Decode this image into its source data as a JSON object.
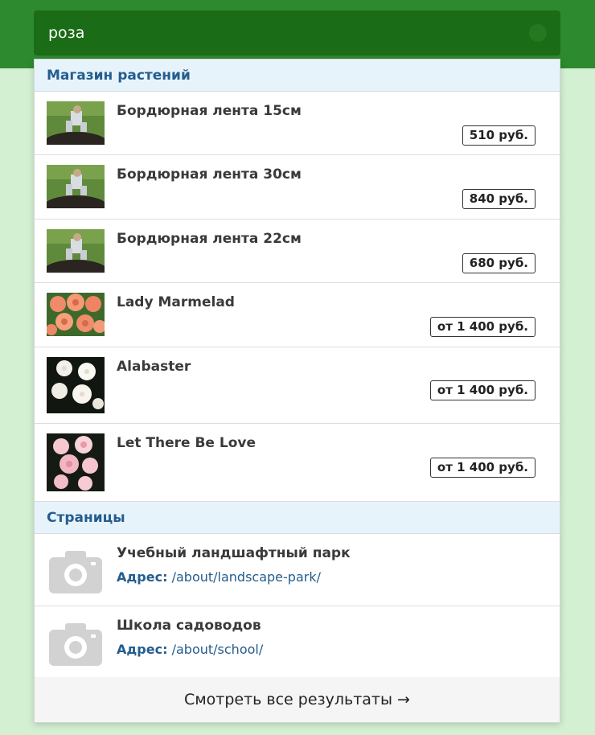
{
  "search": {
    "value": "роза"
  },
  "groups": {
    "shop": {
      "title": "Магазин растений",
      "items": [
        {
          "title": "Бордюрная лента 15см",
          "price": "510 руб."
        },
        {
          "title": "Бордюрная лента 30см",
          "price": "840 руб."
        },
        {
          "title": "Бордюрная лента 22см",
          "price": "680 руб."
        },
        {
          "title": "Lady Marmelad",
          "price": "от 1 400 руб."
        },
        {
          "title": "Alabaster",
          "price": "от 1 400 руб."
        },
        {
          "title": "Let There Be Love",
          "price": "от 1 400 руб."
        }
      ]
    },
    "pages": {
      "title": "Страницы",
      "address_label": "Адрес:",
      "items": [
        {
          "title": "Учебный ландшафтный парк",
          "address": "/about/landscape-park/"
        },
        {
          "title": "Школа садоводов",
          "address": "/about/school/"
        }
      ]
    }
  },
  "footer": {
    "view_all": "Смотреть все результаты →"
  },
  "colors": {
    "header_green": "#2d8a2f",
    "search_green": "#1b6c16",
    "background": "#d4f0d3",
    "group_header_bg": "#e7f3fb",
    "link_blue": "#245d8e"
  }
}
